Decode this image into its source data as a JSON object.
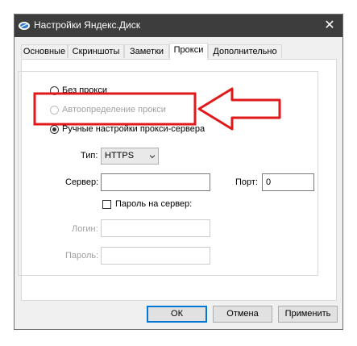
{
  "window": {
    "title": "Настройки Яндекс.Диск",
    "close_glyph": "✕",
    "icon": "yandex-disk-icon"
  },
  "tabs": [
    {
      "label": "Основные",
      "active": false
    },
    {
      "label": "Скриншоты",
      "active": false
    },
    {
      "label": "Заметки",
      "active": false
    },
    {
      "label": "Прокси",
      "active": true
    },
    {
      "label": "Дополнительно",
      "active": false
    }
  ],
  "proxy": {
    "no_proxy_label": "Без прокси",
    "auto_label": "Автоопределение прокси",
    "manual_label": "Ручные настройки прокси-сервера",
    "type_label": "Тип:",
    "type_value": "HTTPS",
    "server_label": "Сервер:",
    "server_value": "",
    "port_label": "Порт:",
    "port_value": "0",
    "auth_label": "Пароль на сервер:",
    "login_label": "Логин:",
    "login_value": "",
    "password_label": "Пароль:",
    "password_value": ""
  },
  "buttons": {
    "ok": "ОК",
    "cancel": "Отмена",
    "apply": "Применить"
  },
  "colors": {
    "annotation": "#e0191b",
    "default_button_border": "#0078d7",
    "titlebar": "#3d3d3d"
  }
}
